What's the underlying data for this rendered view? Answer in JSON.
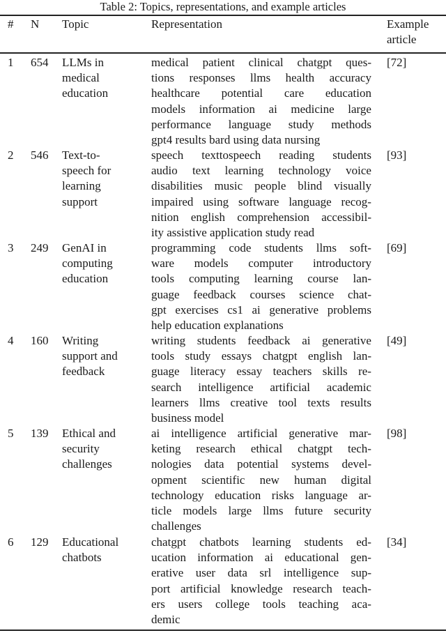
{
  "caption": "Table 2: Topics, representations, and example articles",
  "header": {
    "num": "#",
    "n": "N",
    "topic": "Topic",
    "representation": "Representation",
    "example_lines": [
      "Example",
      "article"
    ]
  },
  "rows": [
    {
      "num": "1",
      "n": "654",
      "topic_lines": [
        "LLMs in",
        "medical",
        "education"
      ],
      "representation_lines": [
        "medical patient clinical chatgpt ques-",
        "tions responses llms health accuracy",
        "healthcare potential care education",
        "models information ai medicine large",
        "performance language study methods",
        "gpt4 results bard using data nursing"
      ],
      "example": "[72]"
    },
    {
      "num": "2",
      "n": "546",
      "topic_lines": [
        "Text-to-",
        "speech for",
        "learning",
        "support"
      ],
      "representation_lines": [
        "speech texttospeech reading students",
        "audio text learning technology voice",
        "disabilities music people blind visually",
        "impaired using software language recog-",
        "nition english comprehension accessibil-",
        "ity assistive application study read"
      ],
      "example": "[93]"
    },
    {
      "num": "3",
      "n": "249",
      "topic_lines": [
        "GenAI in",
        "computing",
        "education"
      ],
      "representation_lines": [
        "programming code students llms soft-",
        "ware models computer introductory",
        "tools computing learning course lan-",
        "guage feedback courses science chat-",
        "gpt exercises cs1 ai generative problems",
        "help education explanations"
      ],
      "example": "[69]"
    },
    {
      "num": "4",
      "n": "160",
      "topic_lines": [
        "Writing",
        "support and",
        "feedback"
      ],
      "representation_lines": [
        "writing students feedback ai generative",
        "tools study essays chatgpt english lan-",
        "guage literacy essay teachers skills re-",
        "search intelligence artificial academic",
        "learners llms creative tool texts results",
        "business model"
      ],
      "example": "[49]"
    },
    {
      "num": "5",
      "n": "139",
      "topic_lines": [
        "Ethical and",
        "security",
        "challenges"
      ],
      "representation_lines": [
        "ai intelligence artificial generative mar-",
        "keting research ethical chatgpt tech-",
        "nologies data potential systems devel-",
        "opment scientific new human digital",
        "technology education risks language ar-",
        "ticle models large llms future security",
        "challenges"
      ],
      "example": "[98]"
    },
    {
      "num": "6",
      "n": "129",
      "topic_lines": [
        "Educational",
        "chatbots"
      ],
      "representation_lines": [
        "chatgpt chatbots learning students ed-",
        "ucation information ai educational gen-",
        "erative user data srl intelligence sup-",
        "port artificial knowledge research teach-",
        "ers users college tools teaching aca-",
        "demic"
      ],
      "example": "[34]"
    }
  ]
}
